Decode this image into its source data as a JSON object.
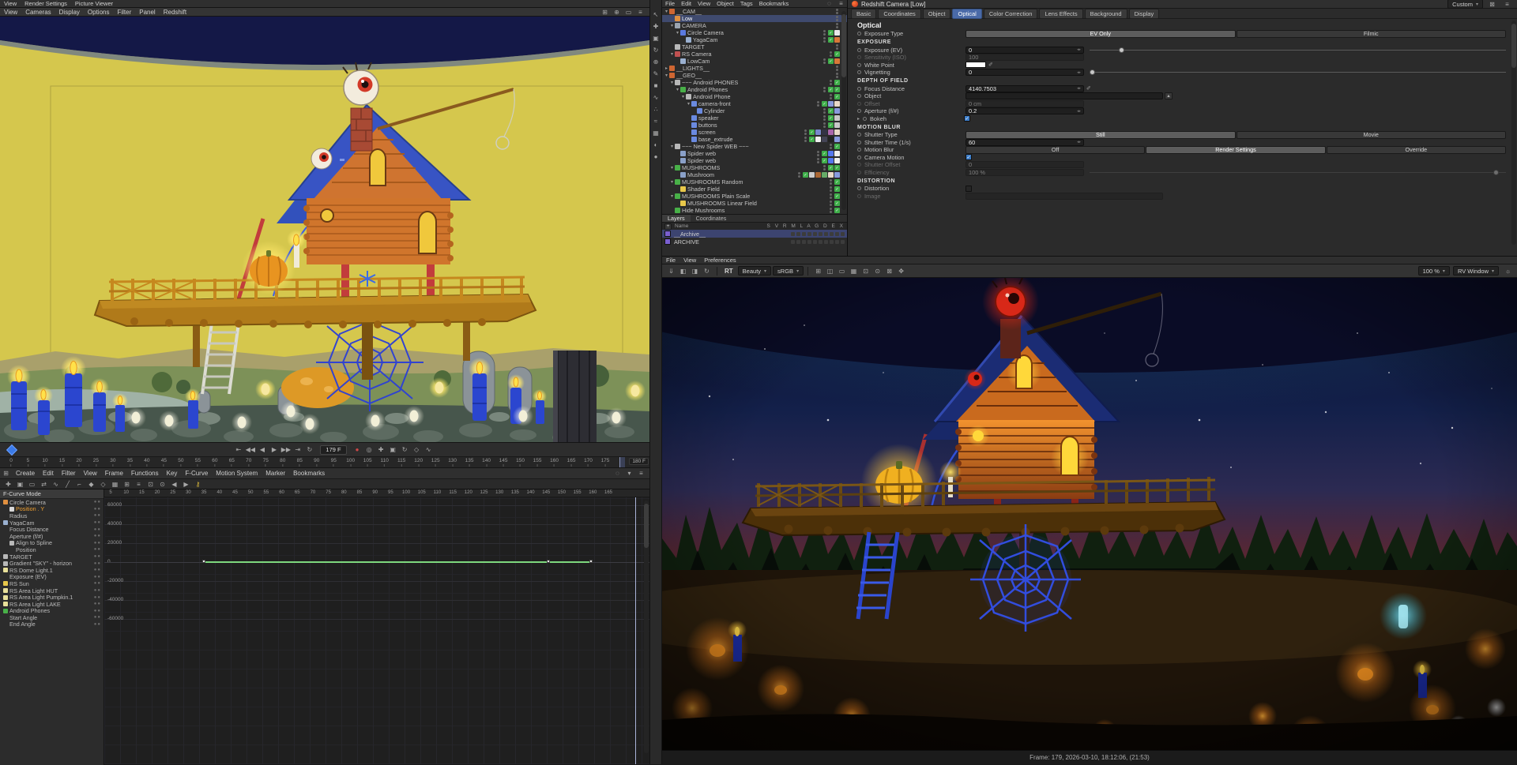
{
  "ui": {
    "accent": "#4a6aa8",
    "selection": "#3f4a6e",
    "curve_green": "#7ed87e"
  },
  "top_left_menu": [
    "View",
    "Render Settings",
    "Picture Viewer"
  ],
  "viewport": {
    "menu": [
      "View",
      "Cameras",
      "Display",
      "Options",
      "Filter",
      "Panel",
      "Redshift"
    ],
    "menu_icons": [
      {
        "n": "grid-toggle-icon",
        "g": "⊞"
      },
      {
        "n": "gizmo-toggle-icon",
        "g": "⊕"
      },
      {
        "n": "safe-frame-icon",
        "g": "▭"
      },
      {
        "n": "viewport-options-icon",
        "g": "≡"
      }
    ]
  },
  "transport": {
    "icons": [
      {
        "n": "go-to-start-button",
        "g": "⇤"
      },
      {
        "n": "previous-key-button",
        "g": "◀◀"
      },
      {
        "n": "previous-frame-button",
        "g": "◀"
      },
      {
        "n": "play-button",
        "g": "▶"
      },
      {
        "n": "next-frame-button",
        "g": "▶▶"
      },
      {
        "n": "next-key-button",
        "g": "⇥"
      },
      {
        "n": "loop-button",
        "g": "↻"
      }
    ],
    "frame_field": "179 F",
    "end_field": "180 F",
    "record_icons": [
      {
        "n": "record-keyframe-button",
        "g": "●",
        "c": "#d04848"
      },
      {
        "n": "autokey-button",
        "g": "◎"
      },
      {
        "n": "record-position-icon",
        "g": "✚"
      },
      {
        "n": "record-scale-icon",
        "g": "▣"
      },
      {
        "n": "record-rotation-icon",
        "g": "↻"
      },
      {
        "n": "record-parameter-icon",
        "g": "◇"
      },
      {
        "n": "record-point-level-icon",
        "g": "∿"
      }
    ]
  },
  "timeline_ruler": {
    "start": 0,
    "end": 175,
    "step": 5,
    "current_frame": 179
  },
  "timeline": {
    "menu": [
      "Create",
      "Edit",
      "Filter",
      "View",
      "Frame",
      "Functions",
      "Key",
      "F-Curve",
      "Motion System",
      "Marker",
      "Bookmarks"
    ],
    "menu_icons": [
      {
        "n": "search-icon",
        "g": "◌"
      },
      {
        "n": "filter-icon",
        "g": "▾"
      },
      {
        "n": "panel-options-icon",
        "g": "≡"
      }
    ],
    "toolbar_icons": [
      {
        "n": "key-move-icon",
        "g": "✚"
      },
      {
        "n": "key-scale-icon",
        "g": "▣"
      },
      {
        "n": "region-select-icon",
        "g": "▭"
      },
      {
        "n": "ripple-edit-icon",
        "g": "⇄"
      },
      {
        "n": "curve-spline-icon",
        "g": "∿"
      },
      {
        "n": "curve-linear-icon",
        "g": "╱"
      },
      {
        "n": "curve-step-icon",
        "g": "⌐"
      },
      {
        "n": "tangent-auto-icon",
        "g": "◆"
      },
      {
        "n": "tangent-break-icon",
        "g": "◇"
      },
      {
        "n": "snap-toggle-icon",
        "g": "▦"
      },
      {
        "n": "quantize-icon",
        "g": "⊞"
      },
      {
        "n": "show-tracks-icon",
        "g": "≡"
      },
      {
        "n": "zoom-fit-icon",
        "g": "⊡"
      },
      {
        "n": "zoom-region-icon",
        "g": "⊙"
      },
      {
        "n": "previous-key-nav-icon",
        "g": "◀"
      },
      {
        "n": "next-key-nav-icon",
        "g": "▶"
      },
      {
        "n": "key-yellow-icon",
        "g": "⚷",
        "c": "#d8b83a"
      }
    ]
  },
  "fcurve": {
    "mode_label": "F-Curve Mode",
    "tree": [
      {
        "l": "Circle Camera",
        "d": 0,
        "i": "#e09040"
      },
      {
        "l": "Position . Y",
        "d": 1,
        "i": "#d8d8d8",
        "sel": true
      },
      {
        "l": "Radius",
        "d": 1
      },
      {
        "l": "YagaCam",
        "d": 0,
        "i": "#9ab0d0"
      },
      {
        "l": "Focus Distance",
        "d": 1
      },
      {
        "l": "Aperture (f/#)",
        "d": 1
      },
      {
        "l": "Align to Spline",
        "d": 1,
        "i": "#b8b8b8"
      },
      {
        "l": "Position",
        "d": 2
      },
      {
        "l": "TARGET",
        "d": 0,
        "i": "#b8b8b8"
      },
      {
        "l": "Gradient \"SKY\" - horizon",
        "d": 0,
        "i": "#b8b8b8"
      },
      {
        "l": "RS Dome Light.1",
        "d": 0,
        "i": "#e8e09a"
      },
      {
        "l": "Exposure (EV)",
        "d": 1
      },
      {
        "l": "RS Sun",
        "d": 0,
        "i": "#e8c84a"
      },
      {
        "l": "RS Area Light HUT",
        "d": 0,
        "i": "#e8e09a"
      },
      {
        "l": "RS Area Light Pumpkin.1",
        "d": 0,
        "i": "#e8e09a"
      },
      {
        "l": "RS Area Light LAKE",
        "d": 0,
        "i": "#e8e09a"
      },
      {
        "l": "Android Phones",
        "d": 0,
        "i": "#48b048"
      },
      {
        "l": "Start Angle",
        "d": 1
      },
      {
        "l": "End Angle",
        "d": 1
      }
    ],
    "graph": {
      "ylabels": [
        "60000",
        "40000",
        "20000",
        "0",
        "-20000",
        "-40000",
        "-60000"
      ],
      "xstart": 5,
      "xend": 165,
      "xstep": 5,
      "curve_value": 0,
      "curve_from_frame": 35,
      "curve_to_frame": 160
    }
  },
  "toolstrip_icons": [
    {
      "n": "live-selection-icon",
      "g": "↖"
    },
    {
      "n": "move-tool-icon",
      "g": "✚"
    },
    {
      "n": "scale-tool-icon",
      "g": "▣"
    },
    {
      "n": "rotate-tool-icon",
      "g": "↻"
    },
    {
      "n": "last-tool-icon",
      "g": "⊕"
    },
    {
      "n": "pen-tool-icon",
      "g": "✎"
    },
    {
      "n": "cube-primitive-icon",
      "g": "■"
    },
    {
      "n": "spline-tool-icon",
      "g": "∿"
    },
    {
      "n": "mograph-icon",
      "g": "∴"
    },
    {
      "n": "simulate-icon",
      "g": "≈"
    },
    {
      "n": "volume-icon",
      "g": "▦"
    },
    {
      "n": "render-icon",
      "g": "◐"
    },
    {
      "n": "material-icon",
      "g": "●"
    }
  ],
  "object_manager": {
    "menu": [
      "File",
      "Edit",
      "View",
      "Object",
      "Tags",
      "Bookmarks"
    ],
    "menu_icons": [
      {
        "n": "om-search-icon",
        "g": "◌"
      },
      {
        "n": "om-options-icon",
        "g": "≡"
      }
    ],
    "tree": [
      {
        "l": "__CAM__",
        "d": 0,
        "i": "#cf6632",
        "e": "open",
        "t": []
      },
      {
        "l": "Low",
        "d": 1,
        "i": "#e09040",
        "e": "none",
        "t": [],
        "sel": true
      },
      {
        "l": "CAMERA",
        "d": 1,
        "i": "#9aa4b0",
        "e": "open",
        "t": []
      },
      {
        "l": "Circle Camera",
        "d": 2,
        "i": "#5a7ae0",
        "e": "open",
        "t": [
          "#3fae4a",
          "#e8e8e8"
        ]
      },
      {
        "l": "YagaCam",
        "d": 3,
        "i": "#9ab0d0",
        "e": "none",
        "t": [
          "#3fae4a",
          "#d87838"
        ]
      },
      {
        "l": "TARGET",
        "d": 1,
        "i": "#b8b8b8",
        "e": "none",
        "t": []
      },
      {
        "l": "RS Camera",
        "d": 1,
        "i": "#c05050",
        "e": "open",
        "t": [
          "#3fae4a"
        ]
      },
      {
        "l": "LowCam",
        "d": 2,
        "i": "#9ab0d0",
        "e": "none",
        "t": [
          "#3fae4a",
          "#d87838"
        ]
      },
      {
        "l": "__LIGHTS__",
        "d": 0,
        "i": "#cf6632",
        "e": "closed",
        "t": []
      },
      {
        "l": "__GEO__",
        "d": 0,
        "i": "#cf6632",
        "e": "open",
        "t": []
      },
      {
        "l": "~~~ Android PHONES",
        "d": 1,
        "i": "#b8b8b8",
        "e": "open",
        "t": [
          "#3fae4a"
        ]
      },
      {
        "l": "Android Phones",
        "d": 2,
        "i": "#48b048",
        "e": "open",
        "t": [
          "#3fae4a",
          "#3fae4a"
        ]
      },
      {
        "l": "Android Phone",
        "d": 3,
        "i": "#b8b8b8",
        "e": "open",
        "t": [
          "#3fae4a"
        ]
      },
      {
        "l": "camera-front",
        "d": 4,
        "i": "#6a8ae0",
        "e": "open",
        "t": [
          "#3fae4a",
          "#8899dd",
          "#e8d8c8"
        ]
      },
      {
        "l": "Cylinder",
        "d": 5,
        "i": "#6a8ae0",
        "e": "none",
        "t": [
          "#3fae4a",
          "#8899dd"
        ]
      },
      {
        "l": "speaker",
        "d": 4,
        "i": "#6a8ae0",
        "e": "none",
        "t": [
          "#3fae4a",
          "#c8c8c8"
        ]
      },
      {
        "l": "buttons",
        "d": 4,
        "i": "#6a8ae0",
        "e": "none",
        "t": [
          "#3fae4a",
          "#c8c8c8"
        ]
      },
      {
        "l": "screen",
        "d": 4,
        "i": "#6a8ae0",
        "e": "none",
        "t": [
          "#3fae4a",
          "#7788cc",
          "#333344",
          "#aa66aa",
          "#e8d8c8"
        ]
      },
      {
        "l": "base_extrude",
        "d": 4,
        "i": "#6a8ae0",
        "e": "none",
        "t": [
          "#3fae4a",
          "#eeeeee",
          "#444455",
          "#222222",
          "#8899dd"
        ]
      },
      {
        "l": "~~~ New Spider WEB ~~~",
        "d": 1,
        "i": "#b8b8b8",
        "e": "open",
        "t": [
          "#3fae4a"
        ]
      },
      {
        "l": "Spider web",
        "d": 2,
        "i": "#8aa0c8",
        "e": "none",
        "t": [
          "#3fae4a",
          "#5577ee",
          "#eeeeee"
        ]
      },
      {
        "l": "Spider web",
        "d": 2,
        "i": "#8aa0c8",
        "e": "none",
        "t": [
          "#3fae4a",
          "#5577ee",
          "#eeeeee"
        ]
      },
      {
        "l": "MUSHROOMS",
        "d": 1,
        "i": "#48b048",
        "e": "open",
        "t": [
          "#3fae4a",
          "#3fae4a"
        ]
      },
      {
        "l": "Mushroom",
        "d": 2,
        "i": "#8aa0c8",
        "e": "none",
        "t": [
          "#3fae4a",
          "#cccccc",
          "#aa6633",
          "#66aa66",
          "#e8d8c8",
          "#8899dd"
        ]
      },
      {
        "l": "MUSHROOMS Random",
        "d": 1,
        "i": "#48b048",
        "e": "open",
        "t": [
          "#3fae4a"
        ]
      },
      {
        "l": "Shader Field",
        "d": 2,
        "i": "#e8c84a",
        "e": "none",
        "t": [
          "#3fae4a"
        ]
      },
      {
        "l": "MUSHROOMS Plain Scale",
        "d": 1,
        "i": "#48b048",
        "e": "open",
        "t": [
          "#3fae4a"
        ]
      },
      {
        "l": "MUSHROOMS Linear Field",
        "d": 2,
        "i": "#e8c84a",
        "e": "none",
        "t": [
          "#3fae4a"
        ]
      },
      {
        "l": "Hide Mushrooms",
        "d": 1,
        "i": "#48b048",
        "e": "none",
        "t": [
          "#3fae4a"
        ]
      }
    ],
    "layer_tabs": [
      "Layers",
      "Coordinates"
    ],
    "layers": {
      "add_label": "+",
      "name_col": "Name",
      "cols": "S V R M L A G D E X",
      "rows": [
        {
          "name": "__Archive__",
          "color": "#7a5fd0",
          "selected": true
        },
        {
          "name": "ARCHIVE",
          "color": "#7a5fd0",
          "selected": false
        }
      ]
    }
  },
  "attributes": {
    "title": "Redshift Camera [Low]",
    "mode": "Custom",
    "tabs": [
      "Basic",
      "Coordinates",
      "Object",
      "Optical",
      "Color Correction",
      "Lens Effects",
      "Background",
      "Display"
    ],
    "active_tab": "Optical",
    "section_title": "Optical",
    "exposure_type": {
      "label": "Exposure Type",
      "options": [
        "EV Only",
        "Filmic"
      ],
      "selected": "EV Only"
    },
    "groups": {
      "exposure": "EXPOSURE",
      "dof": "DEPTH OF FIELD",
      "motion_blur": "MOTION BLUR",
      "distortion": "DISTORTION"
    },
    "exposure_ev": {
      "label": "Exposure (EV)",
      "value": "0",
      "slider_pct": 7
    },
    "sensitivity": {
      "label": "Sensitivity (ISO)",
      "value": "100"
    },
    "white_point": {
      "label": "White Point",
      "swatch": "#ffffff"
    },
    "vignetting": {
      "label": "Vignetting",
      "value": "0",
      "slider_pct": 0
    },
    "focus_distance": {
      "label": "Focus Distance",
      "value": "4140.7503"
    },
    "object": {
      "label": "Object",
      "value": ""
    },
    "offset": {
      "label": "Offset",
      "value": "0 cm"
    },
    "aperture": {
      "label": "Aperture (f/#)",
      "value": "0.2"
    },
    "bokeh": {
      "label": "Bokeh",
      "checked": true
    },
    "shutter_type": {
      "label": "Shutter Type",
      "options": [
        "Still",
        "Movie"
      ],
      "selected": "Still"
    },
    "shutter_time": {
      "label": "Shutter Time (1/s)",
      "value": "60"
    },
    "motion_blur": {
      "label": "Motion Blur",
      "options": [
        "Off",
        "Render Settings",
        "Override"
      ],
      "selected": "Render Settings"
    },
    "camera_motion": {
      "label": "Camera Motion",
      "checked": true
    },
    "shutter_offset": {
      "label": "Shutter Offset",
      "value": "0"
    },
    "efficiency": {
      "label": "Efficiency",
      "value": "100 %",
      "slider_pct": 100
    },
    "distortion": {
      "label": "Distortion",
      "checked": false
    },
    "image": {
      "label": "Image",
      "value": ""
    }
  },
  "picture_viewer": {
    "menu": [
      "File",
      "View",
      "Preferences"
    ],
    "left_icons": [
      {
        "n": "save-image-icon",
        "g": "⇓"
      },
      {
        "n": "compare-a-icon",
        "g": "◧"
      },
      {
        "n": "compare-b-icon",
        "g": "◨"
      },
      {
        "n": "refresh-render-icon",
        "g": "↻"
      }
    ],
    "rt_label": "RT",
    "layer_dropdown": "Beauty",
    "display_dropdown": "sRGB",
    "mid_icons": [
      {
        "n": "snapshot-icon",
        "g": "⊞"
      },
      {
        "n": "compare-ab-icon",
        "g": "◫"
      },
      {
        "n": "region-render-icon",
        "g": "▭"
      },
      {
        "n": "bucket-render-icon",
        "g": "▦"
      },
      {
        "n": "fit-view-icon",
        "g": "⊡"
      },
      {
        "n": "zoom-actual-icon",
        "g": "⊙"
      },
      {
        "n": "fullscreen-icon",
        "g": "⊠"
      },
      {
        "n": "pan-view-icon",
        "g": "✥"
      }
    ],
    "zoom": "100 %",
    "window_dropdown": "RV Window",
    "gear_icon": "☼",
    "status": "Frame: 179, 2026-03-10, 18:12:06, (21:53)"
  }
}
